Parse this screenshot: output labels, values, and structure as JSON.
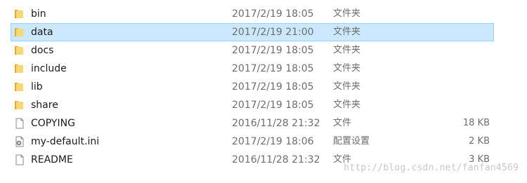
{
  "rows": [
    {
      "name": "bin",
      "date": "2017/2/19 18:05",
      "type": "文件夹",
      "size": "",
      "icon": "folder-icon",
      "selected": false
    },
    {
      "name": "data",
      "date": "2017/2/19 21:00",
      "type": "文件夹",
      "size": "",
      "icon": "folder-icon",
      "selected": true
    },
    {
      "name": "docs",
      "date": "2017/2/19 18:05",
      "type": "文件夹",
      "size": "",
      "icon": "folder-icon",
      "selected": false
    },
    {
      "name": "include",
      "date": "2017/2/19 18:05",
      "type": "文件夹",
      "size": "",
      "icon": "folder-icon",
      "selected": false
    },
    {
      "name": "lib",
      "date": "2017/2/19 18:05",
      "type": "文件夹",
      "size": "",
      "icon": "folder-icon",
      "selected": false
    },
    {
      "name": "share",
      "date": "2017/2/19 18:05",
      "type": "文件夹",
      "size": "",
      "icon": "folder-icon",
      "selected": false
    },
    {
      "name": "COPYING",
      "date": "2016/11/28 21:32",
      "type": "文件",
      "size": "18 KB",
      "icon": "file-icon",
      "selected": false
    },
    {
      "name": "my-default.ini",
      "date": "2017/2/19 18:06",
      "type": "配置设置",
      "size": "2 KB",
      "icon": "settings-file-icon",
      "selected": false
    },
    {
      "name": "README",
      "date": "2016/11/28 21:32",
      "type": "文件",
      "size": "3 KB",
      "icon": "file-icon",
      "selected": false
    }
  ],
  "watermark": "http://blog.csdn.net/fanfan4569",
  "colors": {
    "folder": "#f8d775",
    "folder_dark": "#e0a93a",
    "selection_bg": "#cce8ff",
    "selection_border": "#99d1ff"
  }
}
